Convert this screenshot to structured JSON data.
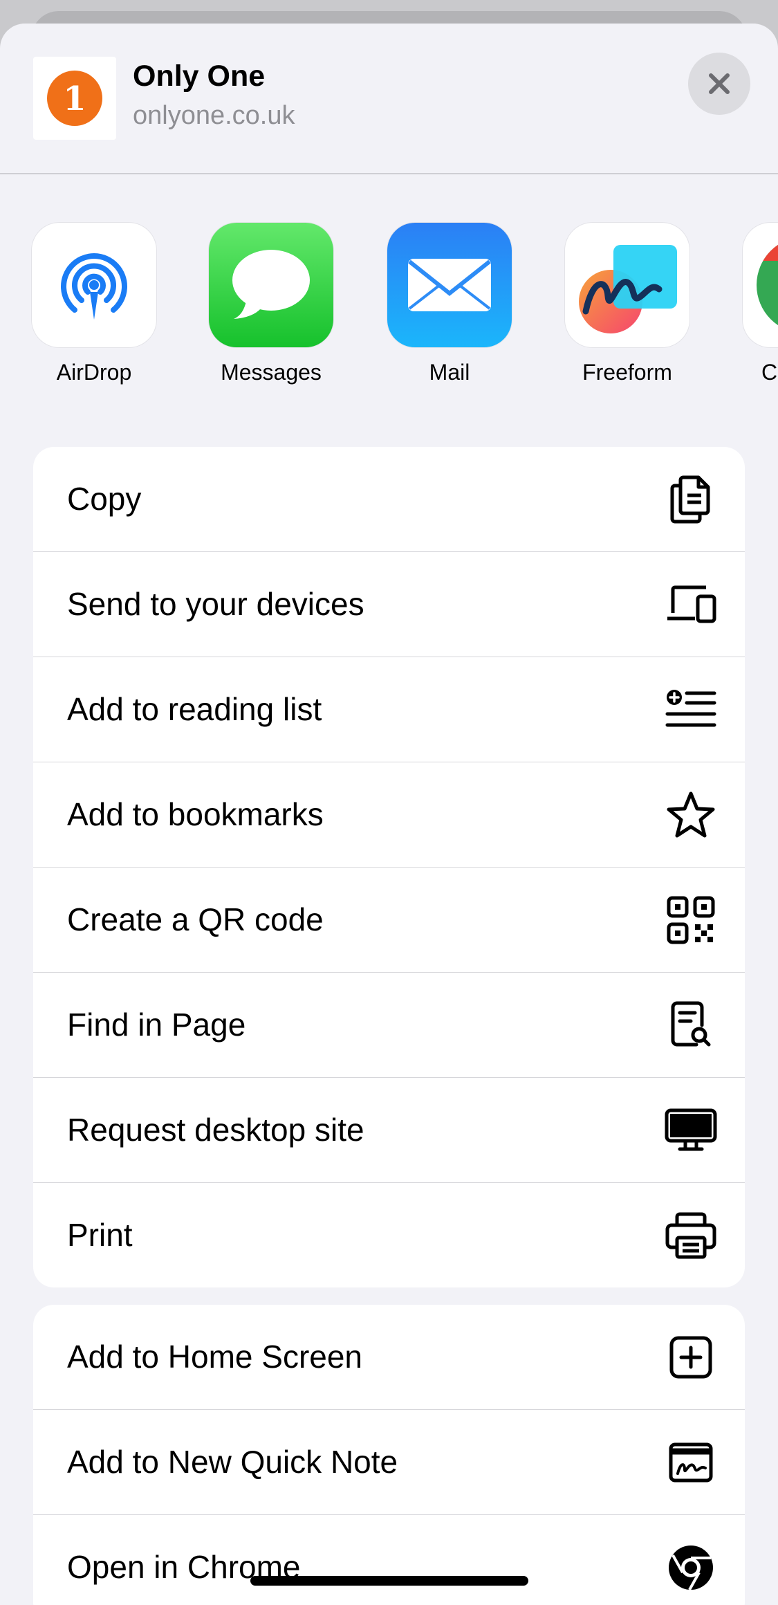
{
  "header": {
    "site_title": "Only One",
    "site_url": "onlyone.co.uk",
    "site_icon_text": "1",
    "brand_color": "#f07018"
  },
  "apps": [
    {
      "label": "AirDrop",
      "icon": "airdrop-icon"
    },
    {
      "label": "Messages",
      "icon": "messages-icon"
    },
    {
      "label": "Mail",
      "icon": "mail-icon"
    },
    {
      "label": "Freeform",
      "icon": "freeform-icon"
    },
    {
      "label": "C",
      "icon": "chrome-icon"
    }
  ],
  "actions_group1": [
    {
      "label": "Copy",
      "icon": "copy-icon"
    },
    {
      "label": "Send to your devices",
      "icon": "devices-icon"
    },
    {
      "label": "Add to reading list",
      "icon": "reading-list-icon"
    },
    {
      "label": "Add to bookmarks",
      "icon": "star-icon"
    },
    {
      "label": "Create a QR code",
      "icon": "qr-code-icon"
    },
    {
      "label": "Find in Page",
      "icon": "find-in-page-icon"
    },
    {
      "label": "Request desktop site",
      "icon": "desktop-icon"
    },
    {
      "label": "Print",
      "icon": "printer-icon"
    }
  ],
  "actions_group2": [
    {
      "label": "Add to Home Screen",
      "icon": "add-square-icon"
    },
    {
      "label": "Add to New Quick Note",
      "icon": "quick-note-icon"
    },
    {
      "label": "Open in Chrome",
      "icon": "chrome-icon"
    }
  ]
}
